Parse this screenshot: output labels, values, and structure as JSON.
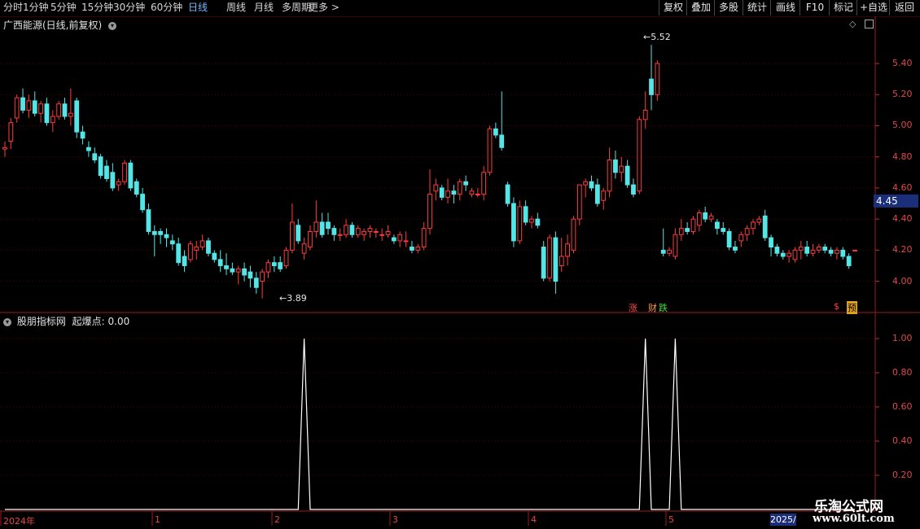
{
  "toolbar": {
    "periods": [
      "分时",
      "1分钟",
      "5分钟",
      "15分钟",
      "30分钟",
      "60分钟",
      "日线",
      "周线",
      "月线",
      "多周期",
      "更多 >"
    ],
    "active_period": "日线",
    "right_tools": [
      "复权",
      "叠加",
      "多股",
      "统计",
      "画线",
      "F10",
      "标记",
      "+自选",
      "返回"
    ]
  },
  "stock": {
    "title": "广西能源(日线,前复权)",
    "current_price": "4.45",
    "high_label": "5.52",
    "low_label": "3.89"
  },
  "price_axis": [
    "5.40",
    "5.20",
    "5.00",
    "4.80",
    "4.60",
    "4.40",
    "4.20",
    "4.00"
  ],
  "indicator": {
    "title": "股朋指标网",
    "value_text": "起爆点: 0.00",
    "axis": [
      "1.00",
      "0.80",
      "0.60",
      "0.40",
      "0.20"
    ]
  },
  "date_axis": {
    "labels": [
      "2024年",
      "1",
      "2",
      "3",
      "4",
      "5"
    ],
    "end_label": "2025/"
  },
  "badges": {
    "zhang": "涨",
    "cai": "财",
    "die": "跌",
    "dollar": "$",
    "yu": "预"
  },
  "watermark": {
    "line1": "乐淘公式网",
    "line2": "www.60lt.com"
  },
  "colors": {
    "up": "#ff3c3c",
    "down": "#54e6e6",
    "grid": "#5a0000"
  },
  "chart_data": [
    {
      "type": "candlestick",
      "title": "广西能源(日线,前复权)",
      "ylim": [
        3.82,
        5.62
      ],
      "y_ticks": [
        4.0,
        4.2,
        4.4,
        4.6,
        4.8,
        5.0,
        5.2,
        5.4
      ],
      "x_ticks": [
        "2024年",
        "1",
        "2",
        "3",
        "4",
        "5"
      ],
      "ohlc": [
        [
          4.85,
          4.9,
          4.8,
          4.86
        ],
        [
          4.9,
          5.05,
          4.85,
          5.02
        ],
        [
          5.05,
          5.2,
          5.02,
          5.18
        ],
        [
          5.18,
          5.24,
          5.08,
          5.1
        ],
        [
          5.1,
          5.2,
          5.05,
          5.16
        ],
        [
          5.16,
          5.22,
          5.06,
          5.08
        ],
        [
          5.08,
          5.16,
          5.02,
          5.14
        ],
        [
          5.14,
          5.18,
          5.0,
          5.02
        ],
        [
          5.02,
          5.1,
          4.96,
          5.06
        ],
        [
          5.06,
          5.16,
          5.04,
          5.14
        ],
        [
          5.14,
          5.18,
          5.04,
          5.06
        ],
        [
          5.06,
          5.24,
          5.0,
          5.08
        ],
        [
          5.16,
          5.18,
          4.92,
          4.96
        ],
        [
          4.96,
          5.0,
          4.88,
          4.92
        ],
        [
          4.86,
          4.9,
          4.8,
          4.84
        ],
        [
          4.82,
          4.86,
          4.76,
          4.78
        ],
        [
          4.8,
          4.82,
          4.66,
          4.68
        ],
        [
          4.74,
          4.78,
          4.64,
          4.66
        ],
        [
          4.7,
          4.76,
          4.58,
          4.6
        ],
        [
          4.62,
          4.66,
          4.58,
          4.64
        ],
        [
          4.64,
          4.78,
          4.62,
          4.76
        ],
        [
          4.76,
          4.78,
          4.58,
          4.6
        ],
        [
          4.64,
          4.66,
          4.54,
          4.56
        ],
        [
          4.56,
          4.6,
          4.44,
          4.46
        ],
        [
          4.46,
          4.5,
          4.3,
          4.32
        ],
        [
          4.32,
          4.36,
          4.16,
          4.3
        ],
        [
          4.32,
          4.34,
          4.24,
          4.3
        ],
        [
          4.3,
          4.34,
          4.22,
          4.28
        ],
        [
          4.26,
          4.3,
          4.2,
          4.24
        ],
        [
          4.24,
          4.28,
          4.1,
          4.12
        ],
        [
          4.16,
          4.2,
          4.06,
          4.1
        ],
        [
          4.14,
          4.26,
          4.12,
          4.24
        ],
        [
          4.2,
          4.26,
          4.14,
          4.22
        ],
        [
          4.22,
          4.3,
          4.2,
          4.26
        ],
        [
          4.26,
          4.28,
          4.16,
          4.18
        ],
        [
          4.18,
          4.2,
          4.12,
          4.14
        ],
        [
          4.14,
          4.2,
          4.06,
          4.1
        ],
        [
          4.1,
          4.18,
          4.04,
          4.08
        ],
        [
          4.08,
          4.12,
          4.04,
          4.06
        ],
        [
          4.06,
          4.1,
          3.98,
          4.08
        ],
        [
          4.08,
          4.12,
          4.0,
          4.04
        ],
        [
          4.06,
          4.1,
          3.96,
          4.02
        ],
        [
          4.02,
          4.06,
          3.92,
          3.96
        ],
        [
          4.0,
          4.08,
          3.89,
          4.06
        ],
        [
          4.06,
          4.14,
          4.02,
          4.12
        ],
        [
          4.12,
          4.16,
          4.06,
          4.1
        ],
        [
          4.12,
          4.16,
          4.06,
          4.08
        ],
        [
          4.1,
          4.22,
          4.08,
          4.2
        ],
        [
          4.2,
          4.5,
          4.18,
          4.38
        ],
        [
          4.36,
          4.4,
          4.24,
          4.26
        ],
        [
          4.18,
          4.28,
          4.14,
          4.24
        ],
        [
          4.22,
          4.36,
          4.2,
          4.32
        ],
        [
          4.32,
          4.52,
          4.28,
          4.38
        ],
        [
          4.38,
          4.44,
          4.28,
          4.3
        ],
        [
          4.38,
          4.44,
          4.3,
          4.34
        ],
        [
          4.34,
          4.36,
          4.26,
          4.3
        ],
        [
          4.3,
          4.34,
          4.26,
          4.3
        ],
        [
          4.3,
          4.4,
          4.28,
          4.36
        ],
        [
          4.36,
          4.38,
          4.28,
          4.3
        ],
        [
          4.3,
          4.36,
          4.28,
          4.34
        ],
        [
          4.3,
          4.34,
          4.26,
          4.32
        ],
        [
          4.32,
          4.36,
          4.28,
          4.34
        ],
        [
          4.32,
          4.34,
          4.28,
          4.32
        ],
        [
          4.3,
          4.34,
          4.26,
          4.3
        ],
        [
          4.3,
          4.36,
          4.28,
          4.32
        ],
        [
          4.28,
          4.3,
          4.24,
          4.26
        ],
        [
          4.26,
          4.32,
          4.22,
          4.3
        ],
        [
          4.26,
          4.32,
          4.22,
          4.26
        ],
        [
          4.22,
          4.26,
          4.18,
          4.2
        ],
        [
          4.2,
          4.24,
          4.18,
          4.22
        ],
        [
          4.22,
          4.38,
          4.2,
          4.34
        ],
        [
          4.34,
          4.72,
          4.3,
          4.56
        ],
        [
          4.58,
          4.66,
          4.52,
          4.62
        ],
        [
          4.6,
          4.62,
          4.52,
          4.54
        ],
        [
          4.54,
          4.66,
          4.5,
          4.58
        ],
        [
          4.58,
          4.62,
          4.5,
          4.56
        ],
        [
          4.56,
          4.66,
          4.52,
          4.64
        ],
        [
          4.64,
          4.68,
          4.58,
          4.62
        ],
        [
          4.56,
          4.6,
          4.54,
          4.58
        ],
        [
          4.56,
          4.6,
          4.54,
          4.56
        ],
        [
          4.56,
          4.74,
          4.52,
          4.7
        ],
        [
          4.7,
          5.0,
          4.68,
          4.98
        ],
        [
          4.98,
          5.02,
          4.92,
          4.94
        ],
        [
          4.94,
          5.22,
          4.84,
          4.86
        ],
        [
          4.62,
          4.64,
          4.48,
          4.5
        ],
        [
          4.5,
          4.54,
          4.22,
          4.26
        ],
        [
          4.26,
          4.52,
          4.24,
          4.48
        ],
        [
          4.48,
          4.52,
          4.36,
          4.38
        ],
        [
          4.38,
          4.42,
          4.34,
          4.4
        ],
        [
          4.4,
          4.44,
          4.34,
          4.36
        ],
        [
          4.22,
          4.26,
          4.0,
          4.02
        ],
        [
          4.02,
          4.3,
          4.0,
          4.28
        ],
        [
          4.28,
          4.32,
          3.92,
          4.0
        ],
        [
          4.1,
          4.28,
          4.06,
          4.16
        ],
        [
          4.16,
          4.3,
          4.1,
          4.24
        ],
        [
          4.2,
          4.42,
          4.18,
          4.4
        ],
        [
          4.4,
          4.58,
          4.36,
          4.62
        ],
        [
          4.62,
          4.66,
          4.54,
          4.64
        ],
        [
          4.64,
          4.68,
          4.58,
          4.6
        ],
        [
          4.62,
          4.66,
          4.48,
          4.5
        ],
        [
          4.52,
          4.6,
          4.46,
          4.58
        ],
        [
          4.58,
          4.86,
          4.54,
          4.78
        ],
        [
          4.78,
          4.84,
          4.66,
          4.7
        ],
        [
          4.7,
          4.8,
          4.64,
          4.74
        ],
        [
          4.74,
          4.78,
          4.6,
          4.62
        ],
        [
          4.62,
          4.66,
          4.54,
          4.56
        ],
        [
          4.58,
          5.06,
          4.56,
          5.04
        ],
        [
          5.04,
          5.22,
          4.98,
          5.1
        ],
        [
          5.3,
          5.52,
          5.1,
          5.2
        ],
        [
          5.2,
          5.42,
          5.16,
          5.4
        ],
        [
          4.2,
          4.34,
          4.16,
          4.18
        ],
        [
          4.18,
          4.22,
          4.16,
          4.2
        ],
        [
          4.16,
          4.34,
          4.14,
          4.3
        ],
        [
          4.3,
          4.4,
          4.26,
          4.34
        ],
        [
          4.34,
          4.38,
          4.3,
          4.32
        ],
        [
          4.32,
          4.42,
          4.3,
          4.4
        ],
        [
          4.36,
          4.46,
          4.32,
          4.44
        ],
        [
          4.44,
          4.48,
          4.38,
          4.4
        ],
        [
          4.4,
          4.44,
          4.38,
          4.42
        ],
        [
          4.38,
          4.4,
          4.3,
          4.34
        ],
        [
          4.34,
          4.38,
          4.3,
          4.32
        ],
        [
          4.32,
          4.34,
          4.2,
          4.22
        ],
        [
          4.22,
          4.26,
          4.18,
          4.2
        ],
        [
          4.26,
          4.32,
          4.22,
          4.3
        ],
        [
          4.3,
          4.36,
          4.26,
          4.34
        ],
        [
          4.34,
          4.4,
          4.3,
          4.38
        ],
        [
          4.38,
          4.42,
          4.36,
          4.4
        ],
        [
          4.42,
          4.46,
          4.26,
          4.28
        ],
        [
          4.28,
          4.3,
          4.16,
          4.22
        ],
        [
          4.22,
          4.24,
          4.16,
          4.18
        ],
        [
          4.18,
          4.2,
          4.14,
          4.16
        ],
        [
          4.16,
          4.2,
          4.12,
          4.18
        ],
        [
          4.14,
          4.22,
          4.12,
          4.2
        ],
        [
          4.2,
          4.26,
          4.14,
          4.22
        ],
        [
          4.22,
          4.26,
          4.16,
          4.18
        ],
        [
          4.18,
          4.24,
          4.16,
          4.2
        ],
        [
          4.2,
          4.24,
          4.18,
          4.22
        ],
        [
          4.22,
          4.24,
          4.18,
          4.2
        ],
        [
          4.2,
          4.22,
          4.16,
          4.18
        ],
        [
          4.18,
          4.22,
          4.14,
          4.2
        ],
        [
          4.2,
          4.22,
          4.14,
          4.16
        ],
        [
          4.16,
          4.18,
          4.08,
          4.1
        ],
        [
          4.2,
          4.2,
          4.2,
          4.2
        ]
      ]
    },
    {
      "type": "line",
      "title": "股朋指标网",
      "ylabel": "起爆点",
      "ylim": [
        0,
        1.1
      ],
      "y_ticks": [
        0.2,
        0.4,
        0.6,
        0.8,
        1.0
      ],
      "peaks_at_index": [
        50,
        107,
        112
      ],
      "values_description_note": "0 everywhere except 1.0 at the peak indices"
    }
  ]
}
